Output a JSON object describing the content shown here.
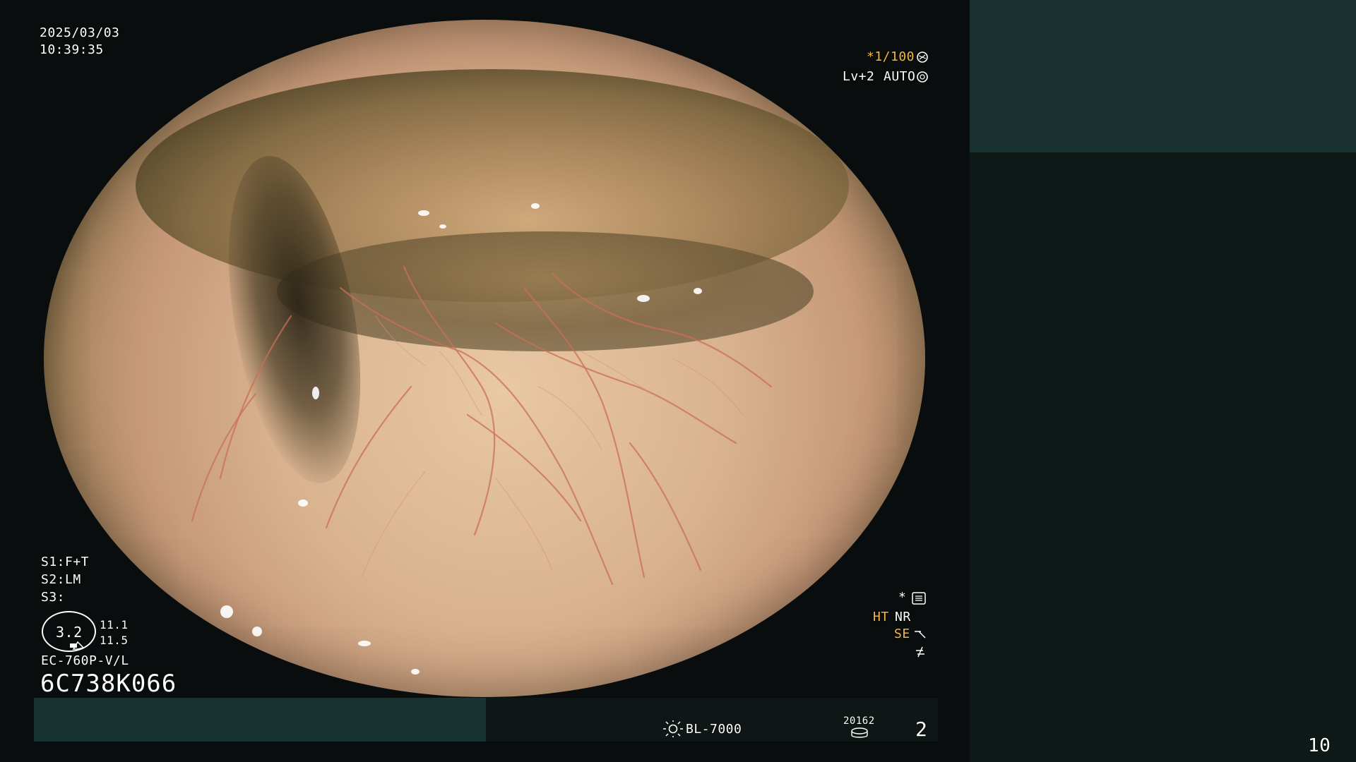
{
  "overlay": {
    "date": "2025/03/03",
    "time": "10:39:35",
    "shutter": "*1/100",
    "level": "Lv+2",
    "mode": "AUTO",
    "s1": "S1:F+T",
    "s2": "S2:LM",
    "s3": "S3:",
    "scope_value": "3.2",
    "scope_right_1": "11.1",
    "scope_right_2": "11.5",
    "scope_model": "EC-760P-V/L",
    "scope_serial": "6C738K066",
    "ht_label": "HT",
    "nr_label": "NR",
    "se_label": "SE",
    "bl_label": "BL-7000",
    "counter": "20162",
    "counter_index": "2",
    "page_number": "10",
    "star": "*"
  },
  "colors": {
    "orange": "#f4b840",
    "panel_dark": "#0f1a18",
    "panel_teal": "#193231"
  }
}
